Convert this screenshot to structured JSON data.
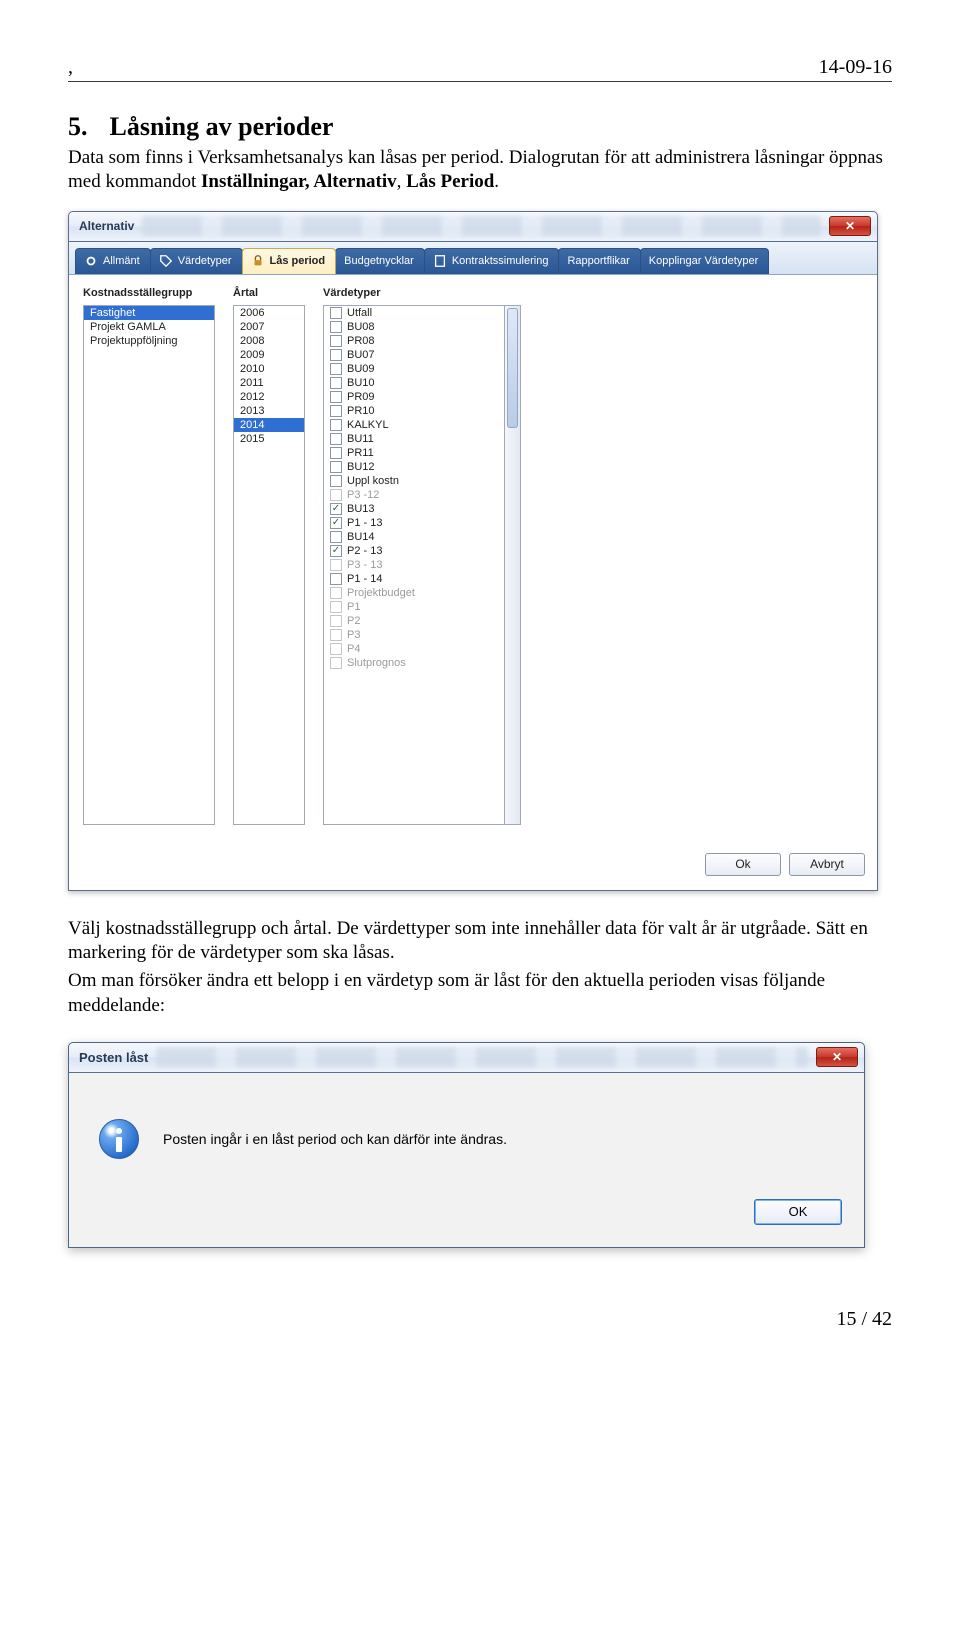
{
  "header": {
    "left": ",",
    "right": "14-09-16"
  },
  "heading": {
    "number": "5.",
    "title": "Låsning av perioder"
  },
  "intro_1": "Data som finns i Verksamhetsanalys kan låsas per period. Dialogrutan för att administrera låsningar öppnas med kommandot ",
  "intro_bold": "Inställningar, Alternativ",
  "intro_2": ", ",
  "intro_bold2": "Lås Period",
  "intro_3": ".",
  "alt_dialog": {
    "title": "Alternativ",
    "tabs": [
      "Allmänt",
      "Värdetyper",
      "Lås period",
      "Budgetnycklar",
      "Kontraktssimulering",
      "Rapportflikar",
      "Kopplingar Värdetyper"
    ],
    "active_tab": 2,
    "col1_label": "Kostnadsställegrupp",
    "col1_items": [
      "Fastighet",
      "Projekt GAMLA",
      "Projektuppföljning"
    ],
    "col1_selected": 0,
    "col2_label": "Årtal",
    "col2_items": [
      "2006",
      "2007",
      "2008",
      "2009",
      "2010",
      "2011",
      "2012",
      "2013",
      "2014",
      "2015"
    ],
    "col2_selected": 8,
    "col3_label": "Värdetyper",
    "col3_items": [
      {
        "label": "Utfall",
        "checked": false,
        "gray": false
      },
      {
        "label": "BU08",
        "checked": false,
        "gray": false
      },
      {
        "label": "PR08",
        "checked": false,
        "gray": false
      },
      {
        "label": "BU07",
        "checked": false,
        "gray": false
      },
      {
        "label": "BU09",
        "checked": false,
        "gray": false
      },
      {
        "label": "BU10",
        "checked": false,
        "gray": false
      },
      {
        "label": "PR09",
        "checked": false,
        "gray": false
      },
      {
        "label": "PR10",
        "checked": false,
        "gray": false
      },
      {
        "label": "KALKYL",
        "checked": false,
        "gray": false
      },
      {
        "label": "BU11",
        "checked": false,
        "gray": false
      },
      {
        "label": "PR11",
        "checked": false,
        "gray": false
      },
      {
        "label": "BU12",
        "checked": false,
        "gray": false
      },
      {
        "label": "Uppl kostn",
        "checked": false,
        "gray": false
      },
      {
        "label": "P3 -12",
        "checked": false,
        "gray": true
      },
      {
        "label": "BU13",
        "checked": true,
        "gray": false
      },
      {
        "label": "P1 - 13",
        "checked": true,
        "gray": false
      },
      {
        "label": "BU14",
        "checked": false,
        "gray": false
      },
      {
        "label": "P2 - 13",
        "checked": true,
        "gray": false
      },
      {
        "label": "P3 - 13",
        "checked": false,
        "gray": true
      },
      {
        "label": "P1 - 14",
        "checked": false,
        "gray": false
      },
      {
        "label": "Projektbudget",
        "checked": false,
        "gray": true
      },
      {
        "label": "P1",
        "checked": false,
        "gray": true
      },
      {
        "label": "P2",
        "checked": false,
        "gray": true
      },
      {
        "label": "P3",
        "checked": false,
        "gray": true
      },
      {
        "label": "P4",
        "checked": false,
        "gray": true
      },
      {
        "label": "Slutprognos",
        "checked": false,
        "gray": true
      }
    ],
    "ok": "Ok",
    "cancel": "Avbryt"
  },
  "mid_para_1": "Välj kostnadsställegrupp och årtal. De värdettyper som inte innehåller data för valt år är utgråade. Sätt en markering för de värdetyper som ska låsas.",
  "mid_para_2": "Om man försöker ändra ett belopp i en värdetyp som är låst för den aktuella perioden visas följande meddelande:",
  "locked_dialog": {
    "title": "Posten låst",
    "message": "Posten ingår i en låst period och kan därför inte ändras.",
    "ok": "OK"
  },
  "footer": "15 / 42"
}
